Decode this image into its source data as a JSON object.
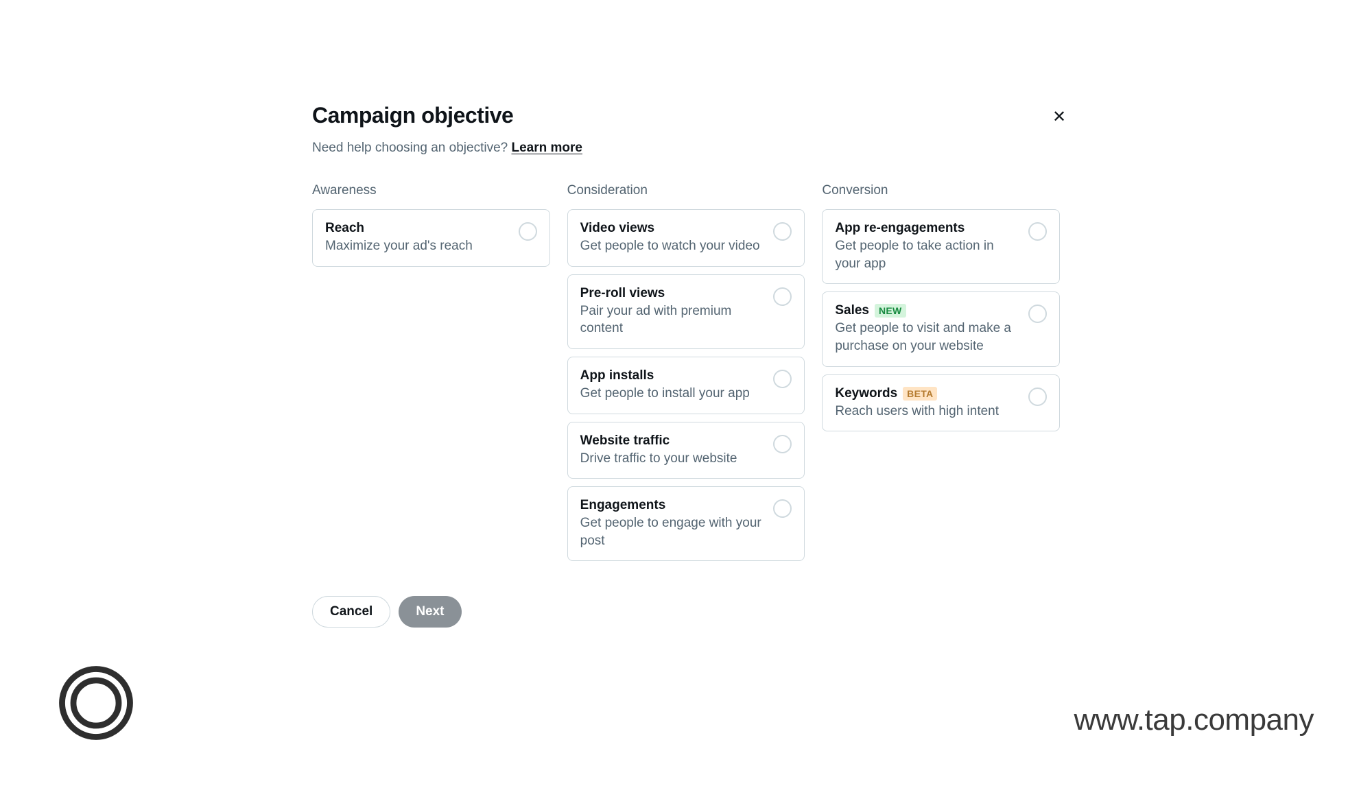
{
  "modal": {
    "title": "Campaign objective",
    "help_text": "Need help choosing an objective? ",
    "learn_more": "Learn more",
    "columns": {
      "awareness": {
        "header": "Awareness",
        "options": [
          {
            "title": "Reach",
            "desc": "Maximize your ad's reach"
          }
        ]
      },
      "consideration": {
        "header": "Consideration",
        "options": [
          {
            "title": "Video views",
            "desc": "Get people to watch your video"
          },
          {
            "title": "Pre-roll views",
            "desc": "Pair your ad with premium content"
          },
          {
            "title": "App installs",
            "desc": "Get people to install your app"
          },
          {
            "title": "Website traffic",
            "desc": "Drive traffic to your website"
          },
          {
            "title": "Engagements",
            "desc": "Get people to engage with your post"
          }
        ]
      },
      "conversion": {
        "header": "Conversion",
        "options": [
          {
            "title": "App re-engagements",
            "desc": "Get people to take action in your app",
            "badge": null
          },
          {
            "title": "Sales",
            "desc": "Get people to visit and make a purchase on your website",
            "badge": "NEW"
          },
          {
            "title": "Keywords",
            "desc": "Reach users with high intent",
            "badge": "BETA"
          }
        ]
      }
    },
    "buttons": {
      "cancel": "Cancel",
      "next": "Next"
    }
  },
  "branding": {
    "url": "www.tap.company"
  }
}
